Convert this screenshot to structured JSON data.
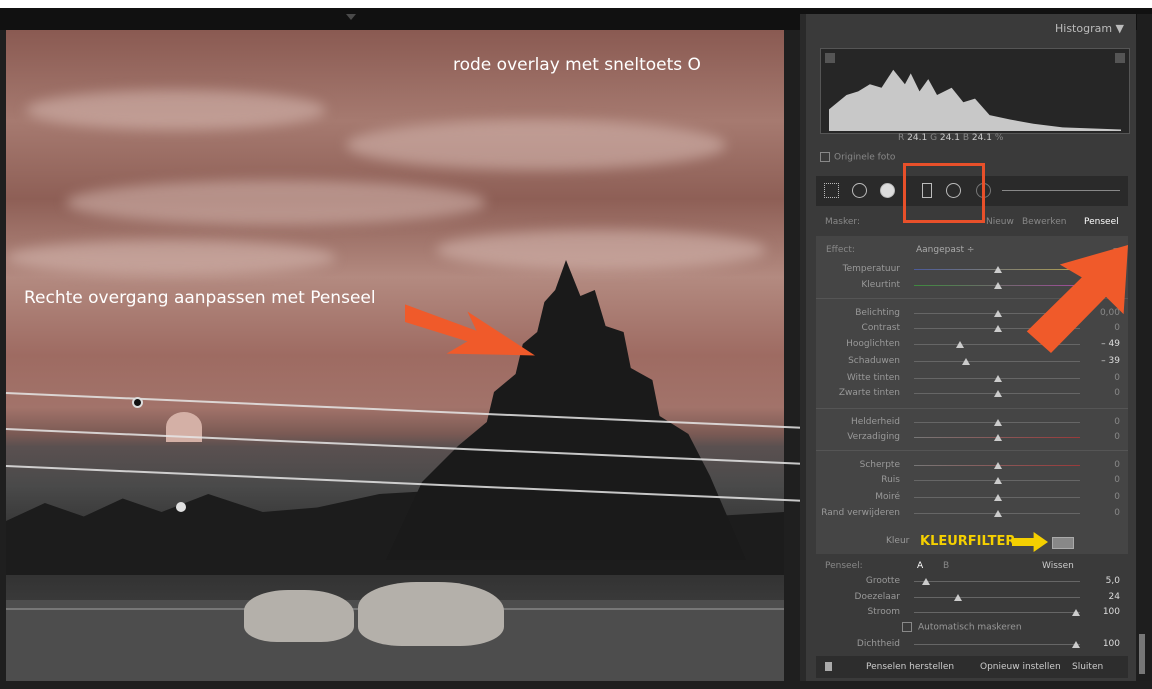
{
  "photo": {
    "caption_overlay": "rode overlay met sneltoets O",
    "caption_gradient": "Rechte overgang aanpassen met Penseel"
  },
  "histogram": {
    "title": "Histogram",
    "r_label": "R",
    "r_value": "24.1",
    "g_label": "G",
    "g_value": "24.1",
    "b_label": "B",
    "b_value": "24.1",
    "unit": "%",
    "original_photo": "Originele foto"
  },
  "mask": {
    "label": "Masker:",
    "new": "Nieuw",
    "edit": "Bewerken",
    "brush": "Penseel"
  },
  "effect": {
    "label": "Effect:",
    "value": "Aangepast ÷"
  },
  "sliders": {
    "temperatuur": {
      "label": "Temperatuur",
      "value": "0"
    },
    "kleurtint": {
      "label": "Kleurtint",
      "value": "0"
    },
    "belichting": {
      "label": "Belichting",
      "value": "0,00"
    },
    "contrast": {
      "label": "Contrast",
      "value": "0"
    },
    "hooglichten": {
      "label": "Hooglichten",
      "value": "– 49"
    },
    "schaduwen": {
      "label": "Schaduwen",
      "value": "– 39"
    },
    "witte": {
      "label": "Witte tinten",
      "value": "0"
    },
    "zwarte": {
      "label": "Zwarte tinten",
      "value": "0"
    },
    "helderheid": {
      "label": "Helderheid",
      "value": "0"
    },
    "verzadiging": {
      "label": "Verzadiging",
      "value": "0"
    },
    "scherpte": {
      "label": "Scherpte",
      "value": "0"
    },
    "ruis": {
      "label": "Ruis",
      "value": "0"
    },
    "moire": {
      "label": "Moiré",
      "value": "0"
    },
    "rand": {
      "label": "Rand verwijderen",
      "value": "0"
    }
  },
  "kleur": {
    "label": "Kleur",
    "annotation": "KLEURFILTER"
  },
  "brush": {
    "label": "Penseel:",
    "a": "A",
    "b": "B",
    "erase": "Wissen",
    "grootte": {
      "label": "Grootte",
      "value": "5,0"
    },
    "doezelaar": {
      "label": "Doezelaar",
      "value": "24"
    },
    "stroom": {
      "label": "Stroom",
      "value": "100"
    },
    "auto_mask": "Automatisch maskeren",
    "dichtheid": {
      "label": "Dichtheid",
      "value": "100"
    }
  },
  "buttons": {
    "reset_brushes": "Penselen herstellen",
    "reset": "Opnieuw instellen",
    "close": "Sluiten"
  }
}
